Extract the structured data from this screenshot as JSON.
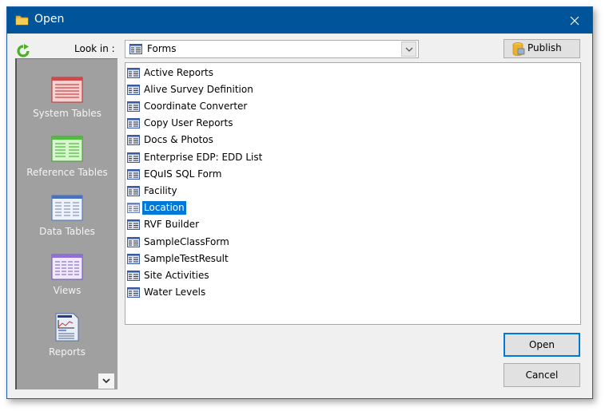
{
  "window": {
    "title": "Open",
    "title_icon": "folder-icon",
    "close_icon": "close-icon",
    "titlebar_color": "#00549a"
  },
  "toolbar": {
    "refresh_icon": "refresh-icon",
    "look_in_label": "Look in :",
    "look_in_value": "Forms",
    "publish_label": "Publish"
  },
  "sidebar": {
    "items": [
      {
        "label": "System Tables",
        "icon": "system-tables-icon"
      },
      {
        "label": "Reference Tables",
        "icon": "reference-tables-icon"
      },
      {
        "label": "Data Tables",
        "icon": "data-tables-icon"
      },
      {
        "label": "Views",
        "icon": "views-icon"
      },
      {
        "label": "Reports",
        "icon": "reports-icon"
      }
    ]
  },
  "file_list": {
    "items": [
      {
        "label": "Active Reports",
        "selected": false
      },
      {
        "label": "Alive Survey Definition",
        "selected": false
      },
      {
        "label": "Coordinate Converter",
        "selected": false
      },
      {
        "label": "Copy User Reports",
        "selected": false
      },
      {
        "label": "Docs & Photos",
        "selected": false
      },
      {
        "label": "Enterprise EDP: EDD List",
        "selected": false
      },
      {
        "label": "EQuIS SQL Form",
        "selected": false
      },
      {
        "label": "Facility",
        "selected": false
      },
      {
        "label": "Location",
        "selected": true
      },
      {
        "label": "RVF Builder",
        "selected": false
      },
      {
        "label": "SampleClassForm",
        "selected": false
      },
      {
        "label": "SampleTestResult",
        "selected": false
      },
      {
        "label": "Site Activities",
        "selected": false
      },
      {
        "label": "Water Levels",
        "selected": false
      }
    ]
  },
  "buttons": {
    "open_label": "Open",
    "cancel_label": "Cancel"
  },
  "colors": {
    "selection": "#0078d7",
    "sidebar_bg": "#a0a0a0"
  }
}
